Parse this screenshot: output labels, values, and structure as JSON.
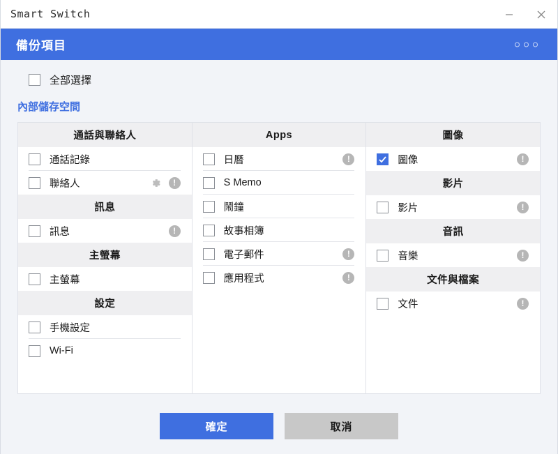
{
  "window": {
    "title": "Smart Switch",
    "minimize_icon": "minimize-icon",
    "close_icon": "close-icon"
  },
  "header": {
    "title": "備份項目",
    "menu_icon": "more-options-icon"
  },
  "select_all": {
    "label": "全部選擇",
    "checked": false
  },
  "storage_link": {
    "label": "內部儲存空間"
  },
  "colors": {
    "accent_blue": "#3f6fe0",
    "page_background": "#f2f4f8",
    "group_header_background": "#efeff1",
    "secondary_button": "#c8c8c8",
    "info_icon_gray": "#b6b6b6"
  },
  "columns": [
    {
      "groups": [
        {
          "title": "通話與聯絡人",
          "items": [
            {
              "label": "通話記錄",
              "checked": false,
              "gear": false,
              "info": false
            },
            {
              "label": "聯絡人",
              "checked": false,
              "gear": true,
              "info": true
            }
          ]
        },
        {
          "title": "訊息",
          "items": [
            {
              "label": "訊息",
              "checked": false,
              "gear": false,
              "info": true
            }
          ]
        },
        {
          "title": "主螢幕",
          "items": [
            {
              "label": "主螢幕",
              "checked": false,
              "gear": false,
              "info": false
            }
          ]
        },
        {
          "title": "設定",
          "items": [
            {
              "label": "手機設定",
              "checked": false,
              "gear": false,
              "info": false
            },
            {
              "label": "Wi-Fi",
              "checked": false,
              "gear": false,
              "info": false
            }
          ]
        }
      ]
    },
    {
      "groups": [
        {
          "title": "Apps",
          "items": [
            {
              "label": "日曆",
              "checked": false,
              "gear": false,
              "info": true
            },
            {
              "label": "S Memo",
              "checked": false,
              "gear": false,
              "info": false
            },
            {
              "label": "鬧鐘",
              "checked": false,
              "gear": false,
              "info": false
            },
            {
              "label": "故事相簿",
              "checked": false,
              "gear": false,
              "info": false
            },
            {
              "label": "電子郵件",
              "checked": false,
              "gear": false,
              "info": true
            },
            {
              "label": "應用程式",
              "checked": false,
              "gear": false,
              "info": true
            }
          ]
        }
      ]
    },
    {
      "groups": [
        {
          "title": "圖像",
          "items": [
            {
              "label": "圖像",
              "checked": true,
              "gear": false,
              "info": true
            }
          ]
        },
        {
          "title": "影片",
          "items": [
            {
              "label": "影片",
              "checked": false,
              "gear": false,
              "info": true
            }
          ]
        },
        {
          "title": "音訊",
          "items": [
            {
              "label": "音樂",
              "checked": false,
              "gear": false,
              "info": true
            }
          ]
        },
        {
          "title": "文件與檔案",
          "items": [
            {
              "label": "文件",
              "checked": false,
              "gear": false,
              "info": true
            }
          ]
        }
      ]
    }
  ],
  "footer": {
    "confirm_label": "確定",
    "cancel_label": "取消"
  },
  "info_glyph": "!"
}
